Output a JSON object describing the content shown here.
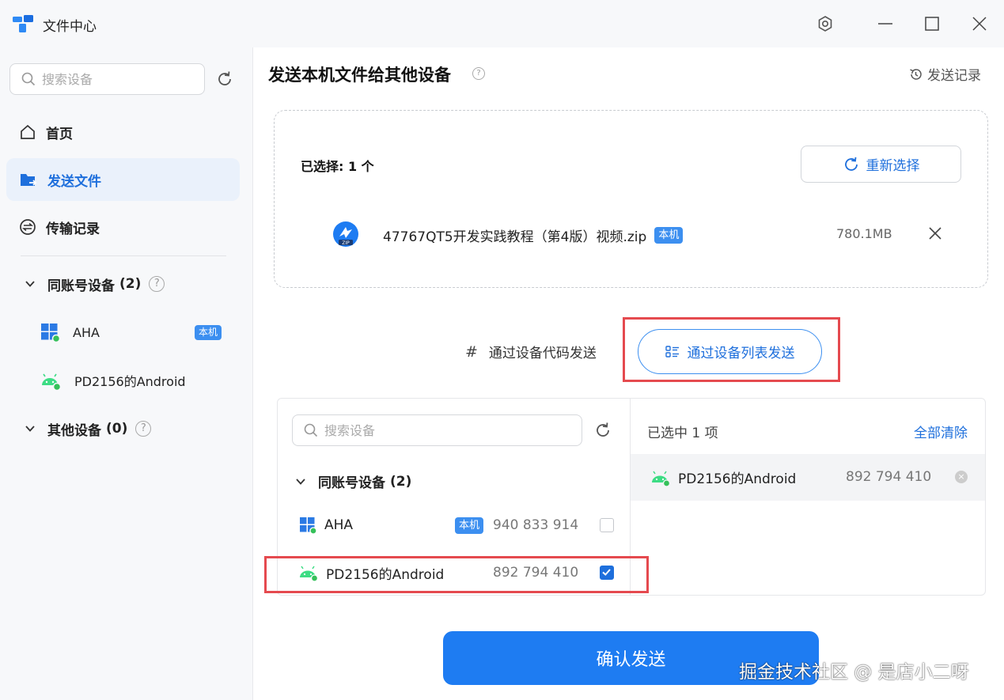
{
  "app": {
    "title": "文件中心"
  },
  "window_controls": {
    "settings_icon": "settings-icon",
    "minimize_icon": "minimize-icon",
    "maximize_icon": "maximize-icon",
    "close_icon": "close-icon"
  },
  "sidebar": {
    "search_placeholder": "搜索设备",
    "nav": [
      {
        "label": "首页",
        "icon": "home-icon"
      },
      {
        "label": "发送文件",
        "icon": "send-file-icon",
        "active": true
      },
      {
        "label": "传输记录",
        "icon": "transfer-record-icon"
      }
    ],
    "groups": [
      {
        "title": "同账号设备",
        "count": "(2)",
        "devices": [
          {
            "name": "AHA",
            "os": "windows",
            "badge": "本机"
          },
          {
            "name": "PD2156的Android",
            "os": "android"
          }
        ]
      },
      {
        "title": "其他设备",
        "count": "(0)",
        "devices": []
      }
    ]
  },
  "main": {
    "title": "发送本机文件给其他设备",
    "history_label": "发送记录",
    "file_panel": {
      "selected_label": "已选择: 1 个",
      "reselect_label": "重新选择",
      "file": {
        "name": "47767QT5开发实践教程（第4版）视频.zip",
        "badge": "本机",
        "size": "780.1MB"
      }
    },
    "send_modes": {
      "by_code": "通过设备代码发送",
      "by_list": "通过设备列表发送"
    },
    "device_picker": {
      "search_placeholder": "搜索设备",
      "group_title": "同账号设备",
      "group_count": "(2)",
      "devices": [
        {
          "name": "AHA",
          "badge": "本机",
          "code": "940 833 914",
          "checked": false
        },
        {
          "name": "PD2156的Android",
          "code": "892 794 410",
          "checked": true
        }
      ],
      "selected_header": "已选中 1 项",
      "clear_all": "全部清除",
      "selected": [
        {
          "name": "PD2156的Android",
          "code": "892 794 410"
        }
      ]
    },
    "confirm_label": "确认发送"
  },
  "watermark": "掘金技术社区 @ 是店小二呀",
  "colors": {
    "accent": "#1e6fdc",
    "highlight_box": "#e54a4f",
    "android_green": "#3ddc84",
    "online_dot": "#35c05a"
  }
}
